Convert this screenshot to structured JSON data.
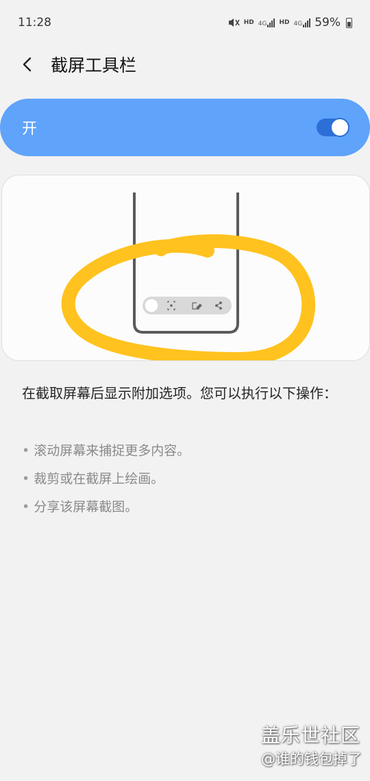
{
  "status_bar": {
    "time": "11:28",
    "battery": "59%",
    "network_4g": "4G",
    "hd": "HD",
    "icons": [
      "mute-vibrate-icon",
      "hd-icon",
      "signal-4g-icon",
      "hd-icon",
      "signal-4g-icon",
      "battery-icon"
    ]
  },
  "header": {
    "title": "截屏工具栏",
    "back_icon": "back-arrow-icon"
  },
  "master_switch": {
    "label": "开",
    "on": true,
    "accent": "#5fa3fb",
    "toggle_color": "#2d6fd7"
  },
  "preview": {
    "toolbar_icons": [
      "circle-button",
      "scroll-capture-icon",
      "edit-icon",
      "share-icon"
    ],
    "annotation_color": "#ffc21f"
  },
  "description": "在截取屏幕后显示附加选项。您可以执行以下操作：",
  "bullets": [
    {
      "text": "滚动屏幕来捕捉更多内容。"
    },
    {
      "text": "裁剪或在截屏上绘画。"
    },
    {
      "text": "分享该屏幕截图。"
    }
  ],
  "bullet_marker": "•",
  "watermark": {
    "site": "盖乐世社区",
    "author": "@谁的钱包掉了"
  }
}
